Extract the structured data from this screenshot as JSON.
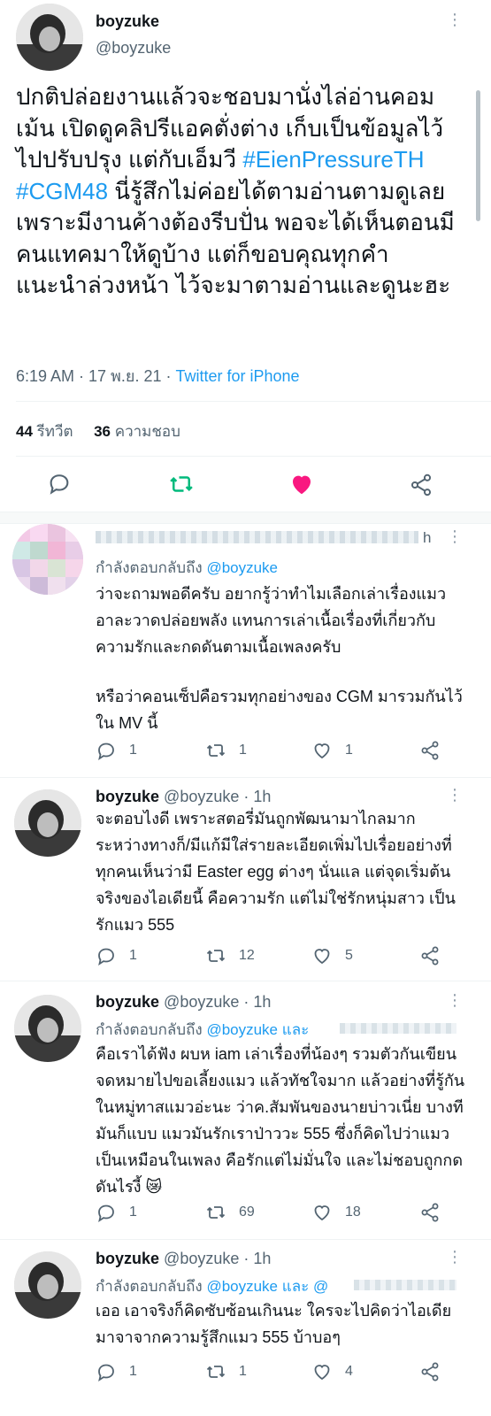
{
  "tweet": {
    "display_name": "boyzuke",
    "handle": "@boyzuke",
    "text_before_tags": "ปกติปล่อยงานแล้วจะชอบมานั่งไล่อ่านคอมเม้น เปิดดูคลิปรีแอคตั่งต่าง เก็บเป็นข้อมูลไว้ไปปรับปรุง แต่กับเอ็มวี",
    "hashtag1": "#EienPressureTH",
    "hashtag2": "#CGM48",
    "text_after_tags": "นี่รู้สึกไม่ค่อยได้ตามอ่านตามดูเลย เพราะมีงานค้างต้องรีบปั่น พอจะได้เห็นตอนมีคนแทคมาให้ดูบ้าง แต่ก็ขอบคุณทุกคำแนะนำล่วงหน้า ไว้จะมาตามอ่านและดูนะฮะ",
    "timestamp": "6:19 AM · 17 พ.ย. 21 · ",
    "source": "Twitter for iPhone",
    "retweet_count": "44",
    "retweet_label": "รีทวีต",
    "like_count": "36",
    "like_label": "ความชอบ"
  },
  "replies": [
    {
      "display_name": "",
      "handle": "",
      "time": "h",
      "replying_to": "กำลังตอบกลับถึง",
      "replying_mention": "@boyzuke",
      "text": "ว่าจะถามพอดีครับ อยากรู้ว่าทำไมเลือกเล่าเรื่องแมวอาละวาดปล่อยพลัง แทนการเล่าเนื้อเรื่องที่เกี่ยวกับความรักและกดดันตามเนื้อเพลงครับ",
      "text2": "หรือว่าคอนเซ็ปคือรวมทุกอย่างของ CGM มารวมกันไว้ใน MV นี้",
      "replies": "1",
      "retweets": "1",
      "likes": "1"
    },
    {
      "display_name": "boyzuke",
      "handle": "@boyzuke · 1h",
      "text": "จะตอบไงดี เพราะสตอรี่มันถูกพัฒนามาไกลมากระหว่างทางก็/มีแก้มีใส่รายละเอียดเพิ่มไปเรื่อยอย่างที่ทุกคนเห็นว่ามี Easter egg ต่างๆ นั่นแล แต่จุดเริ่มต้นจริงของไอเดียนี้ คือความรัก แต่ไม่ใช่รักหนุ่มสาว เป็นรักแมว 555",
      "replies": "1",
      "retweets": "12",
      "likes": "5"
    },
    {
      "display_name": "boyzuke",
      "handle": "@boyzuke · 1h",
      "replying_to": "กำลังตอบกลับถึง",
      "replying_mention": "@boyzuke และ",
      "text": "คือเราได้ฟัง ผบห iam เล่าเรื่องที่น้องๆ รวมตัวกันเขียนจดหมายไปขอเลี้ยงแมว แล้วทัชใจมาก แล้วอย่างที่รู้กันในหมู่ทาสแมวอ่ะนะ ว่าค.สัมพันของนายบ่าวเนี่ย บางทีมันก็แบบ แมวมันรักเราป่าววะ 555 ซึ่งก็คิดไปว่าแมวเป็นเหมือนในเพลง คือรักแต่ไม่มั่นใจ และไม่ชอบถูกกดดันไรงี้",
      "emoji": "😿",
      "replies": "1",
      "retweets": "69",
      "likes": "18"
    },
    {
      "display_name": "boyzuke",
      "handle": "@boyzuke · 1h",
      "replying_to": "กำลังตอบกลับถึง",
      "replying_mention": "@boyzuke และ @",
      "text": "เออ เอาจริงก็คิดซับซ้อนเกินนะ ใครจะไปคิดว่าไอเดียมาจาจากความรู้สึกแมว 555 บ้าบอๆ",
      "replies": "1",
      "retweets": "1",
      "likes": "4"
    }
  ],
  "colors": {
    "accent": "#1d9bf0",
    "retweet_green": "#00ba7c",
    "like_pink": "#f91880",
    "muted": "#536471"
  }
}
